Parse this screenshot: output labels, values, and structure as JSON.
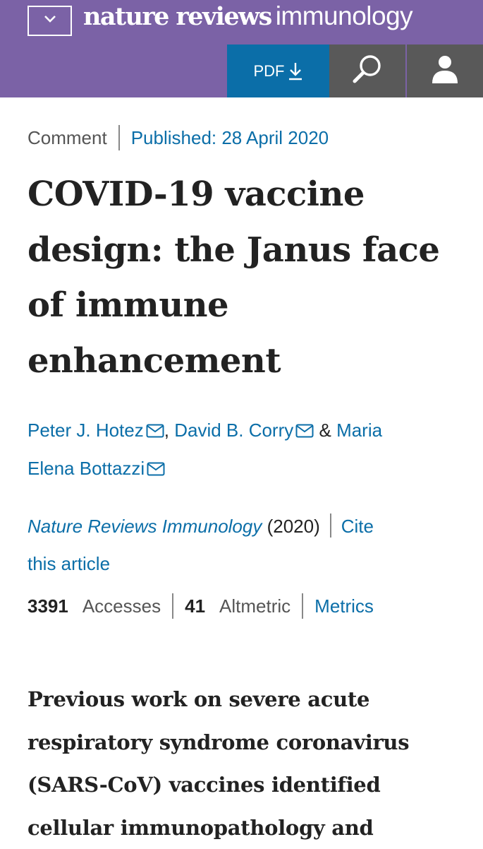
{
  "header": {
    "brand_bold": "nature reviews",
    "brand_light": "immunology",
    "pdf_label": "PDF",
    "colors": {
      "header_bg": "#7b62a6",
      "pdf_bg": "#0b6ea8",
      "icon_bg": "#595959"
    },
    "icons": [
      "chevron-down-icon",
      "download-icon",
      "search-icon",
      "user-icon"
    ]
  },
  "meta": {
    "type": "Comment",
    "published": "Published: 28 April 2020"
  },
  "title": {
    "line1": "COVID-19 vaccine",
    "line2": "design: the Janus face",
    "line3": "of immune",
    "line4": "enhancement"
  },
  "authors": [
    {
      "name": "Peter J. Hotez",
      "icon": "mail-icon"
    },
    {
      "name": "David B. Corry",
      "icon": "mail-icon"
    },
    {
      "name": "Maria Elena Bottazzi",
      "icon": "mail-icon"
    }
  ],
  "authors_sep": {
    "comma": ",",
    "and": "&",
    "first_line_last_author": "Maria",
    "second_line_last_author": "Elena Bottazzi"
  },
  "citation": {
    "journal": "Nature Reviews Immunology",
    "year": "(2020)",
    "cite_line1": "Cite",
    "cite_line2": "this article"
  },
  "metrics": {
    "accesses_count": "3391",
    "accesses_label": "Accesses",
    "altmetric_count": "41",
    "altmetric_label": "Altmetric",
    "metrics_link": "Metrics"
  },
  "abstract": {
    "line1": "Previous work on severe acute",
    "line2": "respiratory syndrome coronavirus",
    "line3": "(SARS-CoV) vaccines identified",
    "line4": "cellular immunopathology and"
  },
  "colors": {
    "link": "#0b6ea8",
    "text": "#222222",
    "muted": "#555555"
  }
}
